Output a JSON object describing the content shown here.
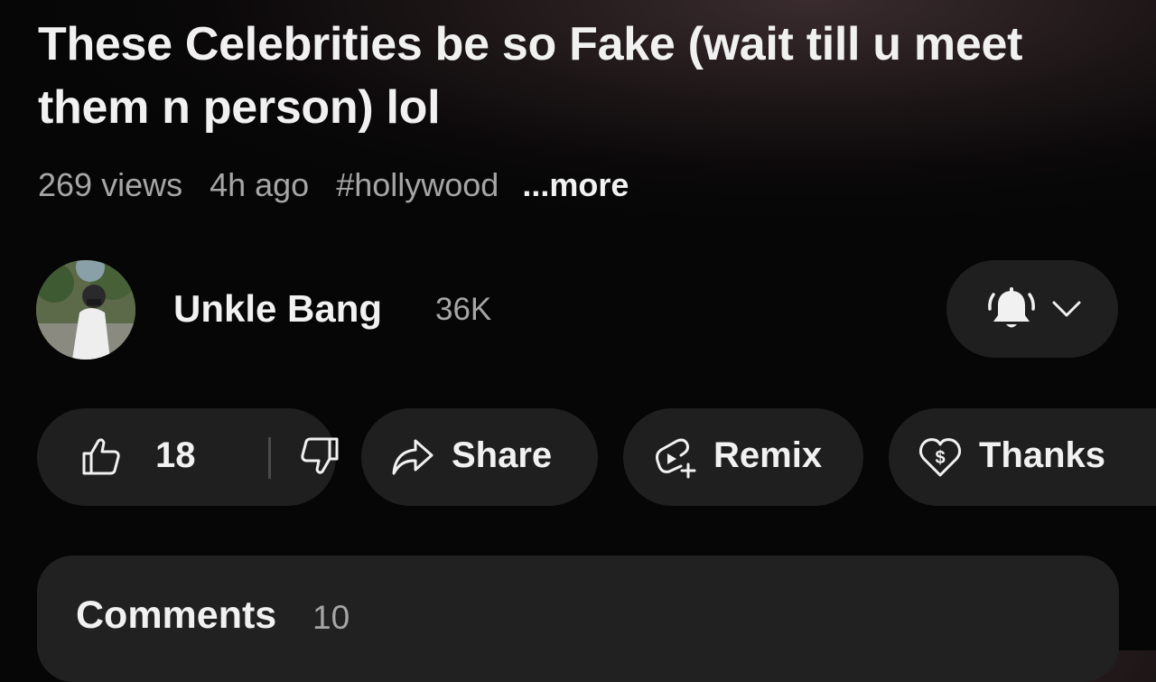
{
  "video": {
    "title": "These Celebrities be so Fake (wait till u meet them n person) lol",
    "views": "269 views",
    "age": "4h ago",
    "hashtag": "#hollywood",
    "more_label": "...more"
  },
  "channel": {
    "name": "Unkle Bang",
    "subscribers": "36K",
    "avatar_icon": "channel-avatar",
    "notification_icon": "bell-ringing-icon",
    "dropdown_icon": "chevron-down-icon"
  },
  "actions": {
    "like_count": "18",
    "like_icon": "thumbs-up-icon",
    "dislike_icon": "thumbs-down-icon",
    "share_label": "Share",
    "share_icon": "share-arrow-icon",
    "remix_label": "Remix",
    "remix_icon": "remix-icon",
    "thanks_label": "Thanks",
    "thanks_icon": "heart-dollar-icon"
  },
  "comments": {
    "heading": "Comments",
    "count": "10"
  },
  "colors": {
    "background": "#060606",
    "pill_background": "#1f1f1f",
    "card_background": "#212121",
    "primary_text": "#f1f1f1",
    "secondary_text": "#a6a6a6"
  }
}
